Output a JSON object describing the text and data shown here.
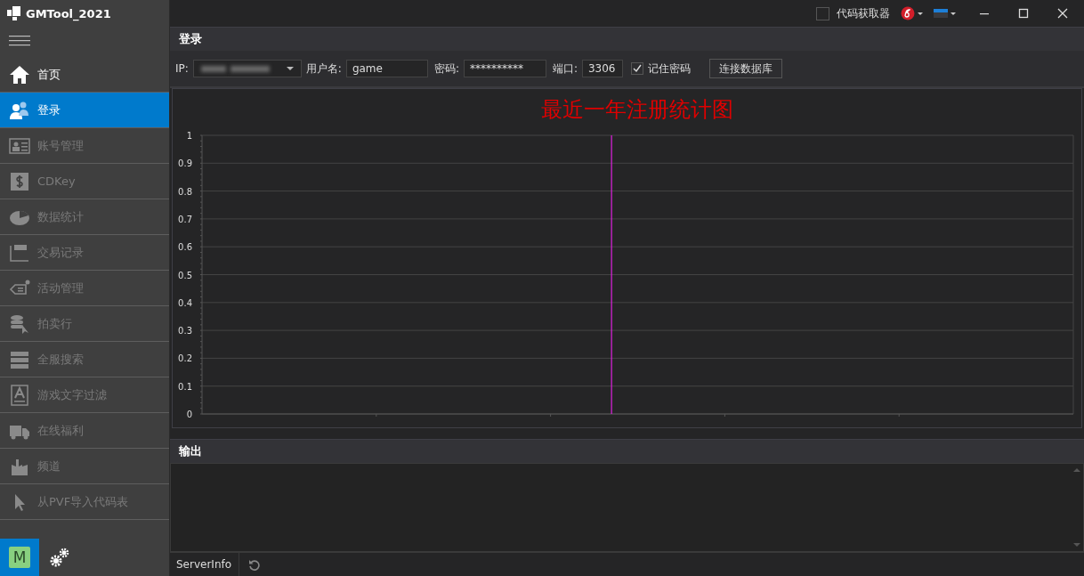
{
  "app": {
    "title": "GMTool_2021"
  },
  "sidebar": {
    "items": [
      {
        "label": "首页",
        "selected": false,
        "disabled": false
      },
      {
        "label": "登录",
        "selected": true,
        "disabled": false
      },
      {
        "label": "账号管理",
        "selected": false,
        "disabled": true
      },
      {
        "label": "CDKey",
        "selected": false,
        "disabled": true
      },
      {
        "label": "数据统计",
        "selected": false,
        "disabled": true
      },
      {
        "label": "交易记录",
        "selected": false,
        "disabled": true
      },
      {
        "label": "活动管理",
        "selected": false,
        "disabled": true
      },
      {
        "label": "拍卖行",
        "selected": false,
        "disabled": true
      },
      {
        "label": "全服搜索",
        "selected": false,
        "disabled": true
      },
      {
        "label": "游戏文字过滤",
        "selected": false,
        "disabled": true
      },
      {
        "label": "在线福利",
        "selected": false,
        "disabled": true
      },
      {
        "label": "频道",
        "selected": false,
        "disabled": true
      },
      {
        "label": "从PVF导入代码表",
        "selected": false,
        "disabled": true
      }
    ],
    "avatar": "M"
  },
  "titlebar": {
    "code_fetcher": {
      "label": "代码获取器",
      "checked": false
    }
  },
  "login_panel": {
    "title": "登录",
    "ip_label": "IP:",
    "username_label": "用户名:",
    "username": "game",
    "password_label": "密码:",
    "password": "**********",
    "port_label": "端口:",
    "port": "3306",
    "remember": {
      "label": "记住密码",
      "checked": true
    },
    "connect_button": "连接数据库"
  },
  "chart": {
    "chart_data": {
      "type": "line",
      "grid": true,
      "categories": [
        null,
        null,
        null,
        null,
        null
      ],
      "title": "最近一年注册统计图",
      "ylim": [
        0,
        1
      ],
      "yticks": [
        0,
        0.1,
        0.2,
        0.3,
        0.4,
        0.5,
        0.6,
        0.7,
        0.8,
        0.9,
        1
      ]
    }
  },
  "output_panel": {
    "title": "输出"
  },
  "status_bar": {
    "tab": "ServerInfo"
  }
}
